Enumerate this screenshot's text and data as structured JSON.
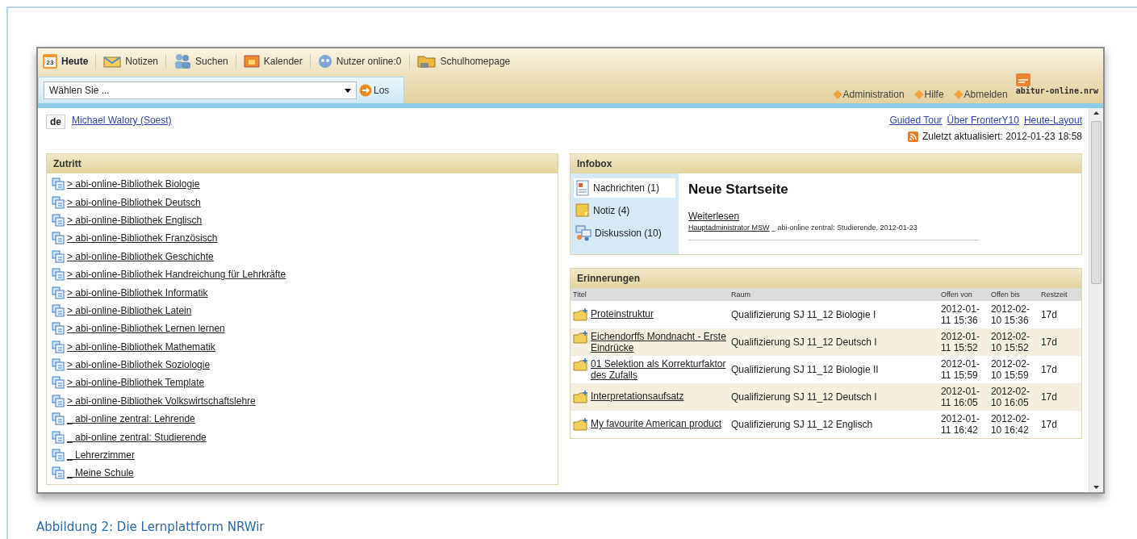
{
  "toolbar": [
    {
      "label": "Heute",
      "kind": "calendar",
      "selected": true
    },
    {
      "label": "Notizen",
      "kind": "envelope",
      "selected": false
    },
    {
      "label": "Suchen",
      "kind": "people",
      "selected": false
    },
    {
      "label": "Kalender",
      "kind": "window",
      "selected": false
    },
    {
      "label": "Nutzer online:0",
      "kind": "face",
      "selected": false
    },
    {
      "label": "Schulhomepage",
      "kind": "folder",
      "selected": false
    }
  ],
  "calendar_day": "23",
  "select": {
    "value": "Wählen Sie ...",
    "button": "Los"
  },
  "logo": "abitur-online.nrw",
  "top_links": [
    "Administration",
    "Hilfe",
    "Abmelden"
  ],
  "language": "de",
  "user": "Michael Walory (Soest)",
  "header_links": [
    "Guided Tour",
    "Über FronterY10",
    "Heute-Layout"
  ],
  "updated": "Zuletzt aktualisiert: 2012-01-23 18:58",
  "zutritt": {
    "title": "Zutritt",
    "items": [
      "> abi-online-Bibliothek Biologie",
      "> abi-online-Bibliothek Deutsch",
      "> abi-online-Bibliothek Englisch",
      "> abi-online-Bibliothek Französisch",
      "> abi-online-Bibliothek Geschichte",
      "> abi-online-Bibliothek Handreichung für Lehrkräfte",
      "> abi-online-Bibliothek Informatik",
      "> abi-online-Bibliothek Latein",
      "> abi-online-Bibliothek Lernen lernen",
      "> abi-online-Bibliothek Mathematik",
      "> abi-online-Bibliothek Soziologie",
      "> abi-online-Bibliothek Template",
      "> abi-online-Bibliothek Volkswirtschaftslehre",
      "_ abi-online zentral: Lehrende",
      "_ abi-online zentral: Studierende",
      "_ Lehrerzimmer",
      "_ Meine Schule"
    ]
  },
  "infobox": {
    "title": "Infobox",
    "tabs": [
      {
        "label": "Nachrichten (1)",
        "kind": "message",
        "selected": true
      },
      {
        "label": "Notiz (4)",
        "kind": "note",
        "selected": false
      },
      {
        "label": "Diskussion (10)",
        "kind": "discussion",
        "selected": false
      }
    ],
    "headline": "Neue Startseite",
    "link": "Weiterlesen",
    "author": "Hauptadministrator MSW",
    "meta": "_ abi-online zentral: Studierende, 2012-01-23"
  },
  "erinnerungen": {
    "title": "Erinnerungen",
    "columns": [
      "Titel",
      "Raum",
      "Offen von",
      "Offen bis",
      "Restzeit"
    ],
    "rows": [
      {
        "title": "Proteinstruktur",
        "room": "Qualifizierung SJ 11_12 Biologie I",
        "from": "2012-01- 11 15:36",
        "to": "2012-02- 10 15:36",
        "rest": "17d"
      },
      {
        "title": "Eichendorffs Mondnacht - Erste Eindrücke",
        "room": "Qualifizierung SJ 11_12 Deutsch I",
        "from": "2012-01- 11 15:52",
        "to": "2012-02- 10 15:52",
        "rest": "17d"
      },
      {
        "title": "01 Selektion als Korrekturfaktor des Zufalls",
        "room": "Qualifizierung SJ 11_12 Biologie II",
        "from": "2012-01- 11 15:59",
        "to": "2012-02- 10 15:59",
        "rest": "17d"
      },
      {
        "title": "Interpretationsaufsatz",
        "room": "Qualifizierung SJ 11_12 Deutsch I",
        "from": "2012-01- 11 16:05",
        "to": "2012-02- 10 16:05",
        "rest": "17d"
      },
      {
        "title": "My favourite American product",
        "room": "Qualifizierung SJ 11_12 Englisch",
        "from": "2012-01- 11 16:42",
        "to": "2012-02- 10 16:42",
        "rest": "17d"
      }
    ]
  },
  "caption": "Abbildung 2: Die Lernplattform NRWir"
}
